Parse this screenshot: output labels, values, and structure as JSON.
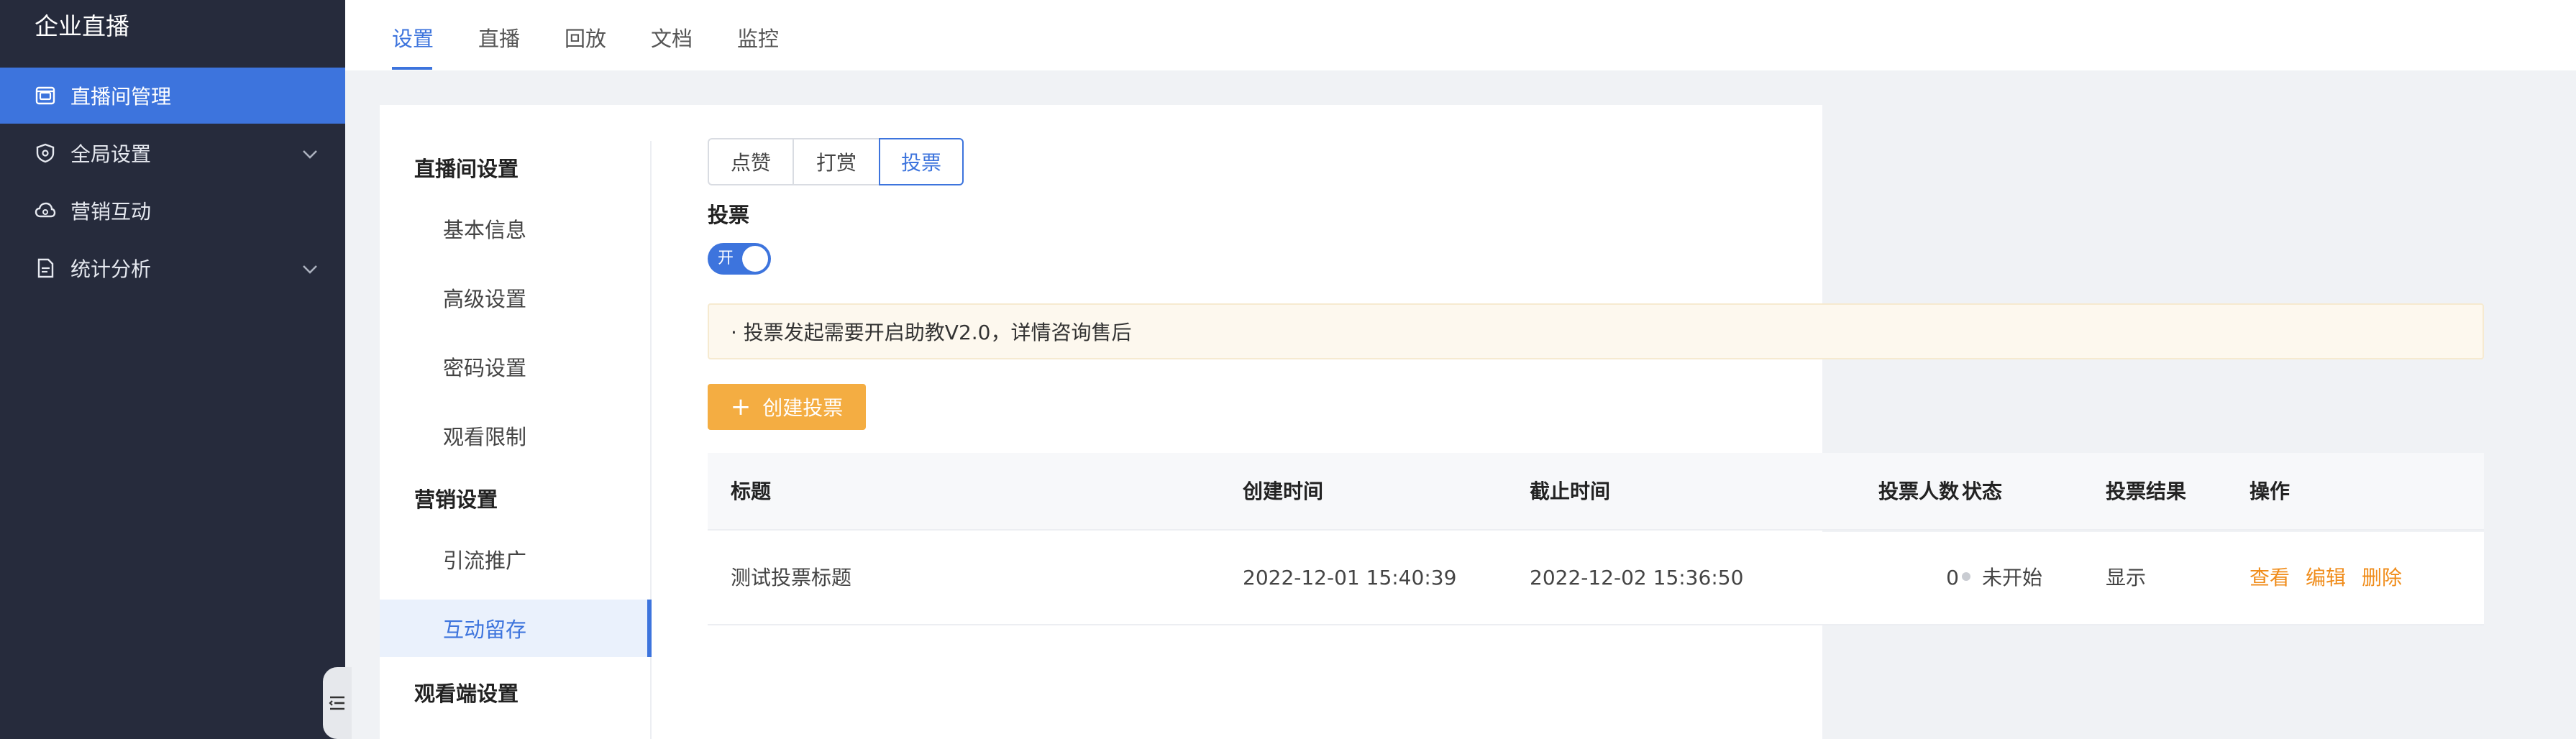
{
  "app": {
    "brand": "企业直播"
  },
  "sidebar": {
    "items": [
      {
        "label": "直播间管理",
        "icon": "live-room-icon",
        "active": true
      },
      {
        "label": "全局设置",
        "icon": "shield-icon",
        "expandable": true
      },
      {
        "label": "营销互动",
        "icon": "cloud-icon"
      },
      {
        "label": "统计分析",
        "icon": "report-icon",
        "expandable": true
      }
    ],
    "collapse_icon": "menu-fold-icon"
  },
  "top_tabs": [
    {
      "label": "设置",
      "active": true
    },
    {
      "label": "直播"
    },
    {
      "label": "回放"
    },
    {
      "label": "文档"
    },
    {
      "label": "监控"
    }
  ],
  "subnav": {
    "groups": [
      {
        "title": "直播间设置",
        "items": [
          "基本信息",
          "高级设置",
          "密码设置",
          "观看限制"
        ]
      },
      {
        "title": "营销设置",
        "items": [
          "引流推广",
          "互动留存"
        ],
        "active_item": "互动留存"
      },
      {
        "title": "观看端设置",
        "items": []
      }
    ]
  },
  "interaction_tabs": [
    {
      "label": "点赞"
    },
    {
      "label": "打赏"
    },
    {
      "label": "投票",
      "active": true
    }
  ],
  "vote_section": {
    "label": "投票",
    "toggle_text": "开",
    "toggle_on": true,
    "notice": "· 投票发起需要开启助教V2.0，详情咨询售后",
    "create_button": "创建投票"
  },
  "table": {
    "columns": [
      "标题",
      "创建时间",
      "截止时间",
      "投票人数",
      "状态",
      "投票结果",
      "操作"
    ],
    "rows": [
      {
        "title": "测试投票标题",
        "created": "2022-12-01 15:40:39",
        "deadline": "2022-12-02 15:36:50",
        "voters": "0",
        "status": "未开始",
        "result": "显示",
        "actions": [
          "查看",
          "编辑",
          "删除"
        ]
      }
    ]
  },
  "colors": {
    "sidebar_bg": "#262b3c",
    "primary": "#3d74dd",
    "warning": "#f4ad42",
    "action_link": "#f08c1a"
  }
}
